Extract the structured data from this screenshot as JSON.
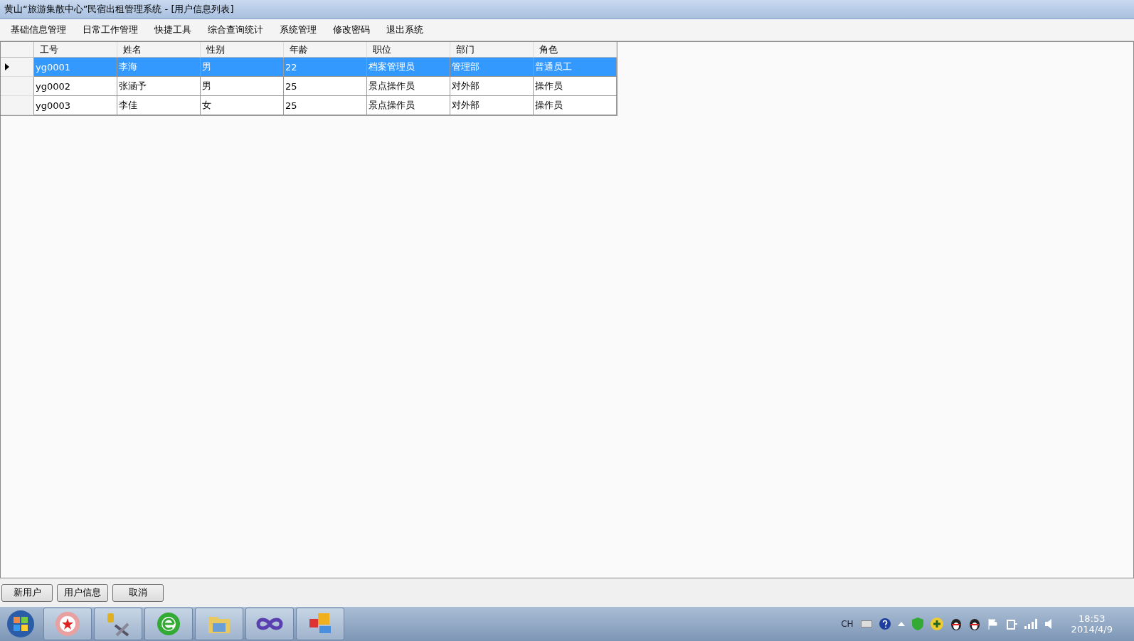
{
  "window": {
    "title": "黄山“旅游集散中心”民宿出租管理系统 - [用户信息列表]"
  },
  "menu": [
    "基础信息管理",
    "日常工作管理",
    "快捷工具",
    "综合查询统计",
    "系统管理",
    "修改密码",
    "退出系统"
  ],
  "table": {
    "columns": [
      "工号",
      "姓名",
      "性别",
      "年龄",
      "职位",
      "部门",
      "角色"
    ],
    "rows": [
      {
        "selected": true,
        "cells": [
          "yg0001",
          "李海",
          "男",
          "22",
          "档案管理员",
          "管理部",
          "普通员工"
        ]
      },
      {
        "selected": false,
        "cells": [
          "yg0002",
          "张涵予",
          "男",
          "25",
          "景点操作员",
          "对外部",
          "操作员"
        ]
      },
      {
        "selected": false,
        "cells": [
          "yg0003",
          "李佳",
          "女",
          "25",
          "景点操作员",
          "对外部",
          "操作员"
        ]
      }
    ]
  },
  "buttons": [
    "新用户",
    "用户信息",
    "取消"
  ],
  "taskbar": {
    "apps": [
      {
        "kind": "badge"
      },
      {
        "kind": "tools"
      },
      {
        "kind": "browser"
      },
      {
        "kind": "folder"
      },
      {
        "kind": "infinity"
      },
      {
        "kind": "tiles"
      }
    ],
    "tray": {
      "language": "CH",
      "time": "18:53",
      "date": "2014/4/9"
    }
  }
}
